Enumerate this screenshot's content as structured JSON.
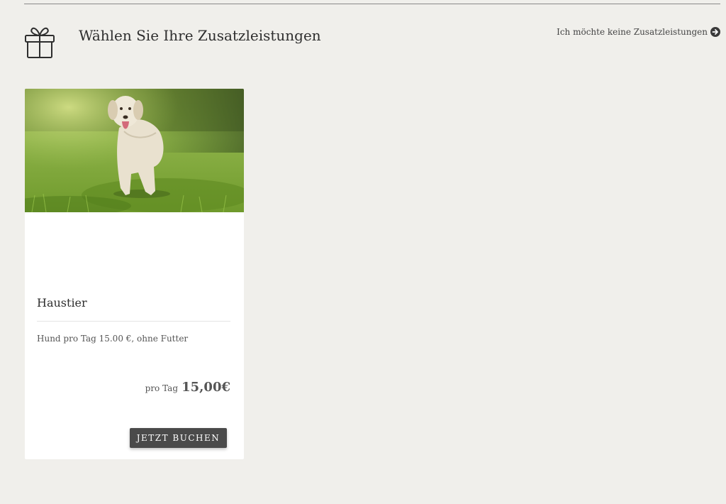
{
  "header": {
    "title": "Wählen Sie Ihre Zusatzleistungen",
    "skip_link": "Ich möchte keine Zusatzleistungen",
    "icon": "gift-icon"
  },
  "card": {
    "image": "dog-on-grass-photo",
    "title": "Haustier",
    "description": "Hund pro Tag 15.00 €, ohne Futter",
    "price_prefix": "pro Tag",
    "price": "15,00€",
    "button_label": "JETZT BUCHEN"
  },
  "colors": {
    "background": "#f0efeb",
    "card": "#ffffff",
    "button": "#4a4a4a"
  }
}
